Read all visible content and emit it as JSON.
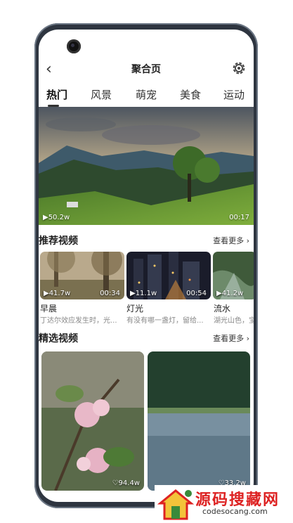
{
  "header": {
    "title": "聚合页",
    "back_icon": "chevron-left-icon",
    "settings_icon": "gear-icon"
  },
  "tabs": [
    {
      "label": "热门",
      "active": true
    },
    {
      "label": "风景",
      "active": false
    },
    {
      "label": "萌宠",
      "active": false
    },
    {
      "label": "美食",
      "active": false
    },
    {
      "label": "运动",
      "active": false
    }
  ],
  "hero": {
    "views": "▶50.2w",
    "duration": "00:17"
  },
  "recommended": {
    "title": "推荐视频",
    "more": "查看更多 ›",
    "items": [
      {
        "views": "▶41.7w",
        "duration": "00:34",
        "title": "早晨",
        "desc": "丁达尔效应发生时，光..."
      },
      {
        "views": "▶11.1w",
        "duration": "00:54",
        "title": "灯光",
        "desc": "有没有哪一盏灯，留给..."
      },
      {
        "views": "▶41.2w",
        "duration": "",
        "title": "流水",
        "desc": "湖光山色，宝"
      }
    ]
  },
  "featured": {
    "title": "精选视频",
    "more": "查看更多 ›",
    "items": [
      {
        "likes": "♡94.4w"
      },
      {
        "likes": "♡33.2w"
      }
    ]
  },
  "brand": {
    "name": "源码搜藏网",
    "url": "codesocang.com"
  },
  "colors": {
    "accent": "#222222",
    "brand_red": "#dd2222",
    "phone_frame": "#2e3540"
  }
}
